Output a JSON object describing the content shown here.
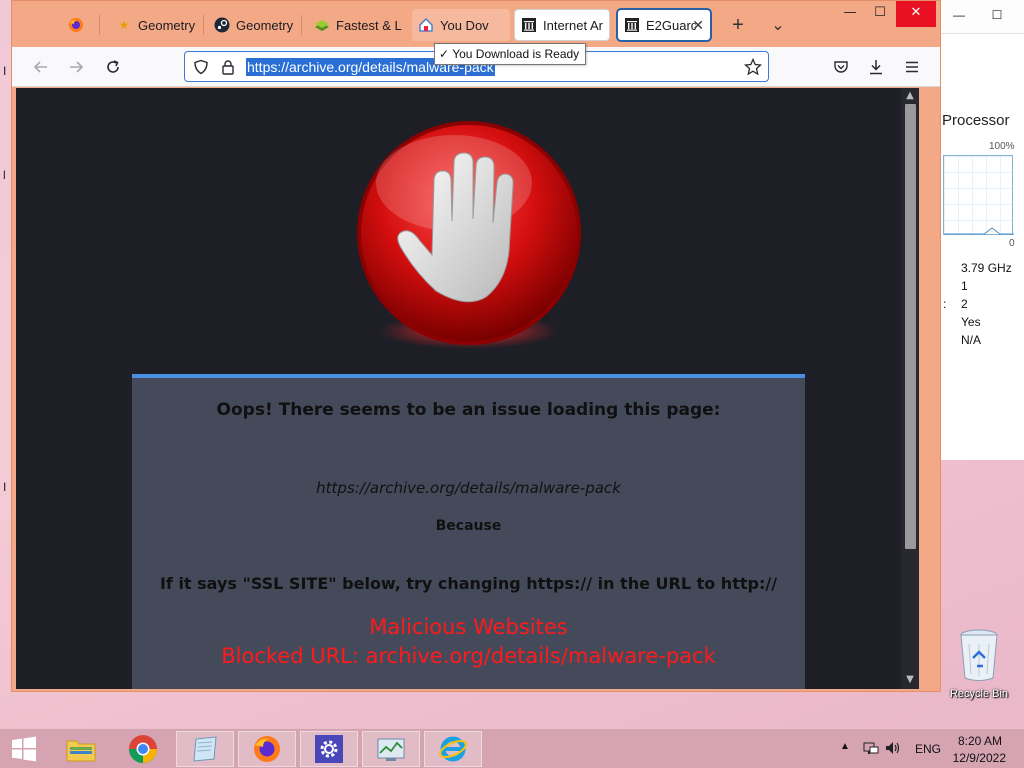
{
  "browser": {
    "tabs": [
      {
        "label": "",
        "icon": "firefox-icon"
      },
      {
        "label": "Geometry",
        "icon": "star-icon"
      },
      {
        "label": "Geometry",
        "icon": "steam-icon"
      },
      {
        "label": "Fastest & L",
        "icon": "layers-icon"
      },
      {
        "label": "You Dov",
        "icon": "house-icon"
      },
      {
        "label": "Internet Ar",
        "icon": "archive-icon"
      },
      {
        "label": "E2Guard",
        "icon": "archive-icon"
      }
    ],
    "new_tab": "+",
    "list_tabs": "⌄",
    "url": "https://archive.org/details/malware-pack",
    "tooltip": "You Download is Ready"
  },
  "page": {
    "heading": "Oops! There seems to be an issue loading this page:",
    "blocked_url": "https://archive.org/details/malware-pack",
    "because": "Because",
    "hint": "If it says \"SSL SITE\" below, try changing https:// in the URL to http://",
    "reason": "Malicious Websites",
    "blocked_line": "Blocked URL: archive.org/details/malware-pack",
    "accent_color": "#ff1a1a"
  },
  "task_manager": {
    "heading": "Processor",
    "graph_max": "100%",
    "graph_min": "0",
    "values": [
      "3.79 GHz",
      "1",
      "2",
      "Yes",
      "N/A"
    ],
    "colon": ":"
  },
  "desktop": {
    "recycle_bin": "Recycle Bin"
  },
  "taskbar": {
    "language": "ENG",
    "time": "8:20 AM",
    "date": "12/9/2022"
  }
}
